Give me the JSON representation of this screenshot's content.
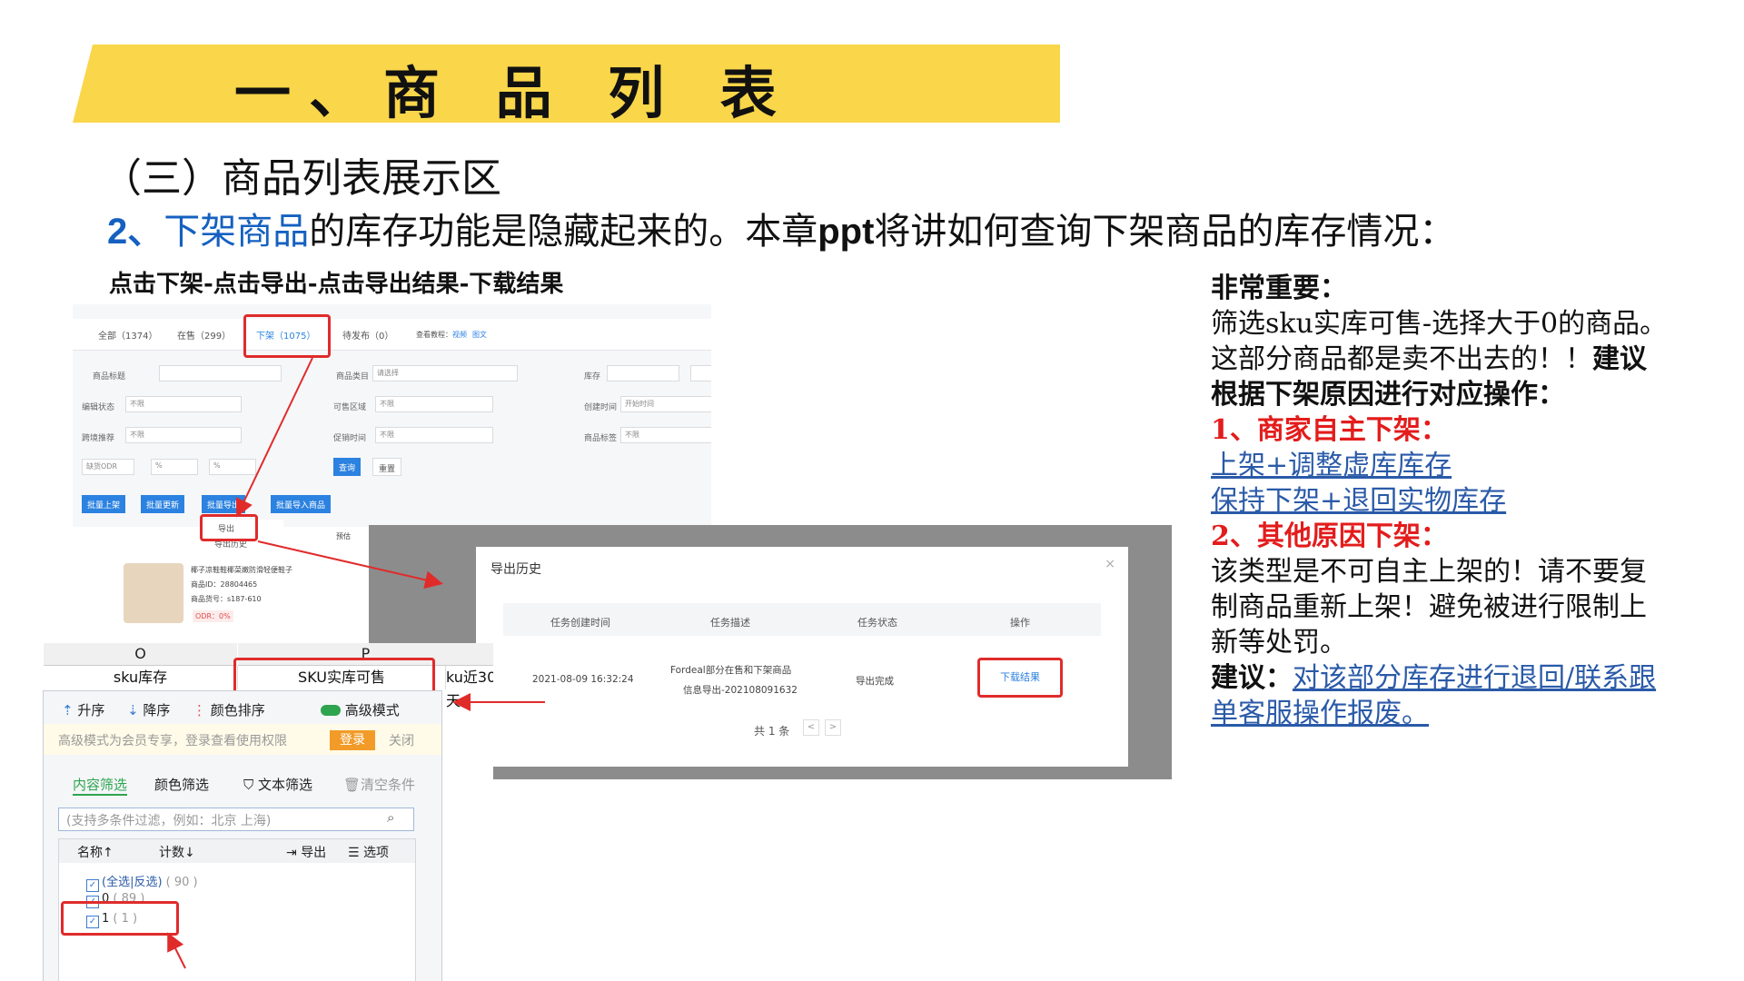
{
  "title": "一、商 品 列 表",
  "subtitle": "（三）商品列表展示区",
  "heading": {
    "num": "2、",
    "highlight": "下架商品",
    "part1": "的库存功能是隐藏起来的。本章",
    "ppt": "ppt",
    "part2": "将讲如何查询下架商品的库存情况："
  },
  "steps": "点击下架-点击导出-点击导出结果-下载结果",
  "note": {
    "l1": "非常重要：",
    "l2": "筛选sku实库可售-选择大于0的商品。",
    "l3a": "这部分商品都是卖不出去的！！",
    "l3b": "建议",
    "l4": "根据下架原因进行对应操作：",
    "l5": "1、商家自主下架：",
    "l6": "上架+调整虚库库存",
    "l7": "保持下架+退回实物库存",
    "l8": "2、其他原因下架：",
    "l9": "该类型是不可自主上架的！请不要复",
    "l10": "制商品重新上架！避免被进行限制上",
    "l11": "新等处罚。",
    "l12a": "建议：",
    "l12b": "对该部分库存进行退回/联系跟",
    "l13": "单客服操作报废。"
  },
  "product_panel": {
    "tabs": [
      "全部（1374）",
      "在售（299）",
      "下架（1075）",
      "待发布（0）"
    ],
    "tab_extra_label": "查看教程：",
    "tab_extra_links": [
      "视频",
      "图文"
    ],
    "filters": {
      "title_label": "商品标题",
      "category_label": "商品类目",
      "category_placeholder": "请选择",
      "stock_label": "库存",
      "edit_status_label": "编辑状态",
      "saleable_label": "可售区域",
      "created_label": "创建时间",
      "created_placeholder": "开始时间",
      "crossborder_label": "跨境推荐",
      "promo_label": "促销时间",
      "tag_label": "商品标签",
      "unlimited": "不限",
      "odr_label": "缺货ODR",
      "percent": "%"
    },
    "buttons": {
      "query": "查询",
      "reset": "重置",
      "batch_on": "批量上架",
      "batch_update": "批量更新",
      "batch_export": "批量导出",
      "batch_import": "批量导入商品"
    },
    "menu": [
      "导出",
      "导出历史"
    ],
    "product": {
      "name": "椰子凉鞋鞋椰菜嫩防滑轻便鞋子",
      "id": "商品ID：28804465",
      "sku": "商品货号：s187-610",
      "odr": "ODR：0%",
      "price_label": "预估"
    }
  },
  "export_dialog": {
    "title": "导出历史",
    "close": "×",
    "headers": [
      "任务创建时间",
      "任务描述",
      "任务状态",
      "操作"
    ],
    "row": {
      "time": "2021-08-09 16:32:24",
      "desc1": "Fordeal部分在售和下架商品",
      "desc2": "信息导出-202108091632",
      "status": "导出完成",
      "action": "下载结果"
    },
    "pager": "共 1 条",
    "prev": "<",
    "next": ">"
  },
  "excel": {
    "col_o": "O",
    "col_p": "P",
    "cell_o": "sku库存",
    "cell_p": "SKU实库可售",
    "cell_q": "ku近30天",
    "toolbar": {
      "asc": "升序",
      "desc": "降序",
      "color_sort": "颜色排序",
      "advanced": "高级模式"
    },
    "notice": "高级模式为会员专享，登录查看使用权限",
    "login": "登录",
    "close": "关闭",
    "tabs": {
      "content": "内容筛选",
      "color": "颜色筛选",
      "text": "文本筛选",
      "clear": "清空条件"
    },
    "search_placeholder": "(支持多条件过滤，例如：北京 上海)",
    "list_header": {
      "name": "名称↑",
      "count": "计数↓",
      "export": "导出",
      "options": "选项"
    },
    "items": [
      {
        "label": "(全选|反选)",
        "count": "( 90 )"
      },
      {
        "label": "0",
        "count": "( 89 )"
      },
      {
        "label": "1",
        "count": "( 1 )"
      }
    ]
  },
  "colors": {
    "banner": "#f9d64a",
    "accent_blue": "#1560c0",
    "red": "#e31c1c",
    "link": "#2a5aa8"
  }
}
